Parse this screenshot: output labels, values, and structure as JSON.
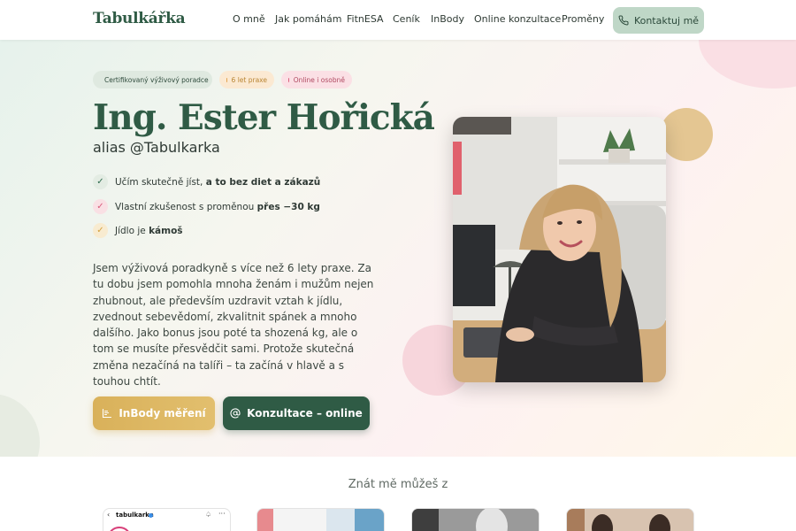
{
  "header": {
    "logo": "Tabulkářka",
    "nav": [
      "O mně",
      "Jak pomáhám",
      "FitnESA",
      "Ceník",
      "InBody",
      "Online konzultace",
      "Proměny"
    ],
    "cta_label": "Kontaktuj mě"
  },
  "hero": {
    "badges": [
      "Certifikovaný výživový poradce",
      "6 let praxe",
      "Online i osobně"
    ],
    "name": "Ing. Ester Hořická",
    "alias": "alias @Tabulkarka",
    "checks": [
      {
        "text": "Učím skutečně jíst, ",
        "bold": "a to bez diet a zákazů"
      },
      {
        "text": "Vlastní zkušenost s proměnou ",
        "bold": "přes −30 kg"
      },
      {
        "text": "Jídlo je ",
        "bold": "kámoš"
      }
    ],
    "description": "Jsem výživová poradkyně s více než 6 lety praxe. Za tu dobu jsem pomohla mnoha ženám i mužům nejen zhubnout, ale především uzdravit vztah k jídlu, zvednout sebevědomí, zkvalitnit spánek a mnoho dalšího. Jako bonus jsou poté ta shozená kg, ale o tom se musíte přesvědčit sami. Protože skutečná změna nezačíná na talíři – ta začíná v hlavě a s touhou chtít.",
    "btn_inbody": "InBody měření",
    "btn_konzultace": "Konzultace – online"
  },
  "section": {
    "heading": "Znát mě můžeš z",
    "card1_handle": "tabulkarka"
  },
  "colors": {
    "brand_green": "#2f5b45",
    "gold": "#d9b15a",
    "pink": "#d85c7b"
  }
}
